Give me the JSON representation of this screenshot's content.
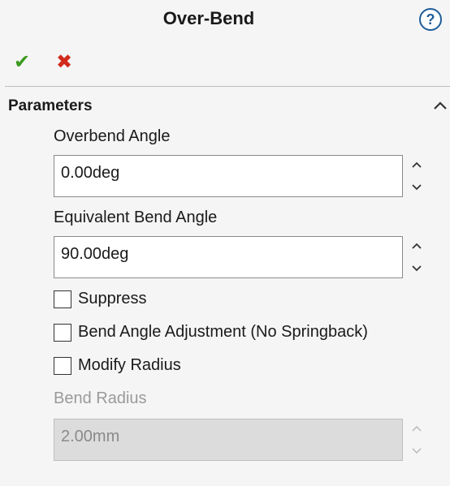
{
  "header": {
    "title": "Over-Bend",
    "help_glyph": "?"
  },
  "actions": {
    "ok_icon": "checkmark-icon",
    "cancel_icon": "x-icon",
    "ok_color": "#3a9a1e",
    "cancel_color": "#d12b1b"
  },
  "parameters": {
    "section_title": "Parameters",
    "overbend_angle": {
      "label": "Overbend Angle",
      "value": "0.00deg"
    },
    "equivalent_bend_angle": {
      "label": "Equivalent Bend Angle",
      "value": "90.00deg"
    },
    "checkboxes": [
      {
        "label": "Suppress",
        "checked": false
      },
      {
        "label": "Bend Angle Adjustment (No Springback)",
        "checked": false
      },
      {
        "label": "Modify Radius",
        "checked": false
      }
    ],
    "bend_radius": {
      "label": "Bend Radius",
      "value": "2.00mm",
      "enabled": false
    }
  }
}
